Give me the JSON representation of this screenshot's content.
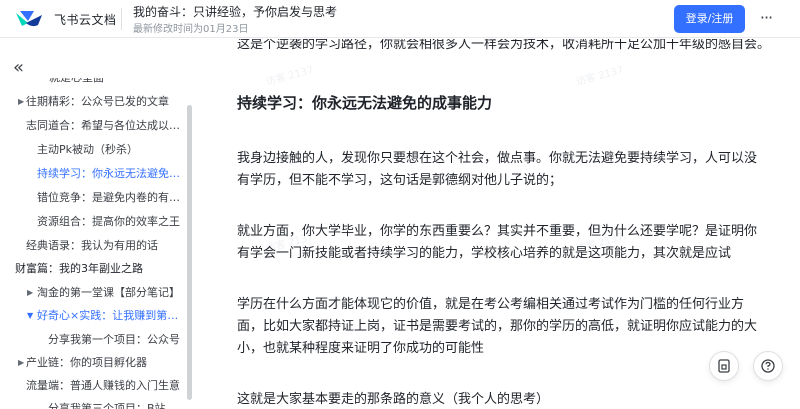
{
  "header": {
    "brand": "飞书云文档",
    "doc_title": "我的奋斗：只讲经验，予你启发与思考",
    "modified": "最新修改时间为01月23日",
    "login_label": "登录/注册",
    "more_label": "···"
  },
  "sidebar": {
    "collapse_label": "«",
    "items": [
      {
        "label": "就是心室面",
        "level": 3
      },
      {
        "label": "往期精彩：公众号已发的文章",
        "level": 2
      },
      {
        "label": "志同道合：希望与各位达成以下共识",
        "level": 2
      },
      {
        "label": "主动Pk被动（秒杀）",
        "level": 3
      },
      {
        "label": "持续学习：你永远无法避免的成事能力",
        "level": 3
      },
      {
        "label": "错位竞争：是避免内卷的有效方法",
        "level": 3
      },
      {
        "label": "资源组合：提高你的效率之王",
        "level": 3
      },
      {
        "label": "经典语录：我认为有用的话",
        "level": 2
      },
      {
        "label": "财富篇：我的3年副业之路",
        "level": 1
      },
      {
        "label": "淘金的第一堂课【部分笔记】",
        "level": 2
      },
      {
        "label": "好奇心×实践：让我赚到第一桶金",
        "level": 2
      },
      {
        "label": "分享我第一个项目：公众号",
        "level": 3
      },
      {
        "label": "产业链：你的项目孵化器",
        "level": 2
      },
      {
        "label": "流量端：普通人赚钱的入门生意",
        "level": 2
      },
      {
        "label": "分享我第三个项目：B站",
        "level": 3
      }
    ]
  },
  "content": {
    "cut_line": "这是个逆袭的学习路径，你就会相很多人一样会为技术，收消耗所十足公加十年级的感自会。",
    "heading": "持续学习：你永远无法避免的成事能力",
    "p1": "我身边接触的人，发现你只要想在这个社会，做点事。你就无法避免要持续学习，人可以没有学历，但不能不学习，这句话是郭德纲对他儿子说的；",
    "p2": "就业方面，你大学毕业，你学的东西重要么？其实并不重要，但为什么还要学呢？是证明你有学会一门新技能或者持续学习的能力，学校核心培养的就是这项能力，其次就是应试",
    "p3": "学历在什么方面才能体现它的价值，就是在考公考编相关通过考试作为门槛的任何行业方面，比如大家都持证上岗，证书是需要考试的，那你的学历的高低，就证明你应试能力的大小，也就某种程度来证明了你成功的可能性",
    "p4": "这就是大家基本要走的那条路的意义（我个人的思考）"
  },
  "watermark_text": "访客 2137",
  "icons": {
    "logo": "feishu-logo",
    "outline": "outline-icon",
    "help": "help-icon"
  },
  "colors": {
    "accent": "#3370ff",
    "text": "#1f2329",
    "muted": "#8f959e"
  }
}
